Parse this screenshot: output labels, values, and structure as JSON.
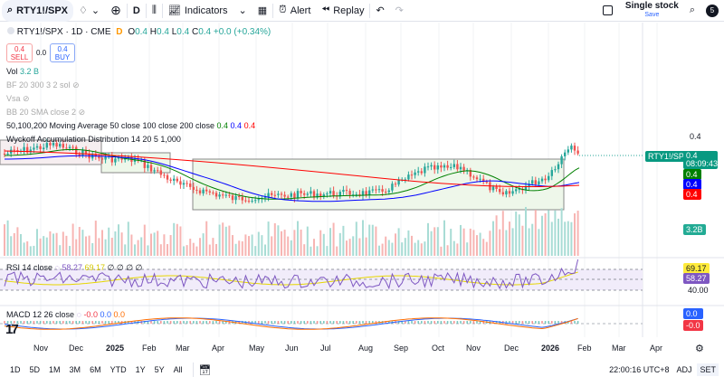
{
  "toolbar": {
    "symbol": "RTY1!/SPX",
    "interval": "D",
    "indicators": "Indicators",
    "alert": "Alert",
    "replay": "Replay",
    "layout_name": "Single stock",
    "layout_sub": "Save",
    "avatar": "5"
  },
  "legend": {
    "title": "RTY1!/SPX · 1D · CME",
    "badge": "D",
    "o_label": "O",
    "o": "0.4",
    "h_label": "H",
    "h": "0.4",
    "l_label": "L",
    "l": "0.4",
    "c_label": "C",
    "c": "0.4",
    "change": "+0.0 (+0.34%)",
    "sell_price": "0.4",
    "sell": "SELL",
    "spread": "0.0",
    "buy_price": "0.4",
    "buy": "BUY",
    "vol_label": "Vol",
    "vol": "3.2 B",
    "bf": "BF 20 300 3 2 sol",
    "vsa": "Vsa",
    "bb": "BB 20 SMA close 2",
    "ma": "50,100,200 Moving Average 50 close 100 close 200 close",
    "ma50": "0.4",
    "ma100": "0.4",
    "ma200": "0.4",
    "wyckoff": "Wyckoff Accumulation Distribution 14 20 5 1,000"
  },
  "price_axis": {
    "top": "0.4",
    "symbol_tag": "RTY1!/SPX",
    "last": "0.4",
    "countdown": "08:09:43",
    "ma50": "0.4",
    "ma100": "0.4",
    "ma200": "0.4",
    "volume": "3.2B"
  },
  "rsi": {
    "label": "RSI 14 close",
    "value": "58.27",
    "ma": "69.17",
    "extra": "∅ ∅ ∅ ∅",
    "axis_ma": "69.17",
    "axis_value": "58.27",
    "level": "40.00"
  },
  "macd": {
    "label": "MACD 12 26 close",
    "hist": "-0.0",
    "macd": "0.0",
    "signal": "0.0",
    "axis_macd": "0.0",
    "axis_hist": "-0.0"
  },
  "time_axis": [
    "Nov",
    "Dec",
    "2025",
    "Feb",
    "Mar",
    "Apr",
    "May",
    "Jun",
    "Jul",
    "Aug",
    "Sep",
    "Oct",
    "Nov",
    "Dec",
    "2026",
    "Feb",
    "Mar",
    "Apr"
  ],
  "bottom": {
    "ranges": [
      "1D",
      "5D",
      "1M",
      "3M",
      "6M",
      "YTD",
      "1Y",
      "5Y",
      "All"
    ],
    "clock": "22:00:16 UTC+8",
    "adj": "ADJ",
    "set": "SET"
  },
  "colors": {
    "up": "#26a69a",
    "down": "#ef5350",
    "ma50": "#008000",
    "ma100": "#0000ff",
    "ma200": "#ff0000",
    "rsi": "#7e57c2",
    "rsi_ma": "#e6d600"
  }
}
